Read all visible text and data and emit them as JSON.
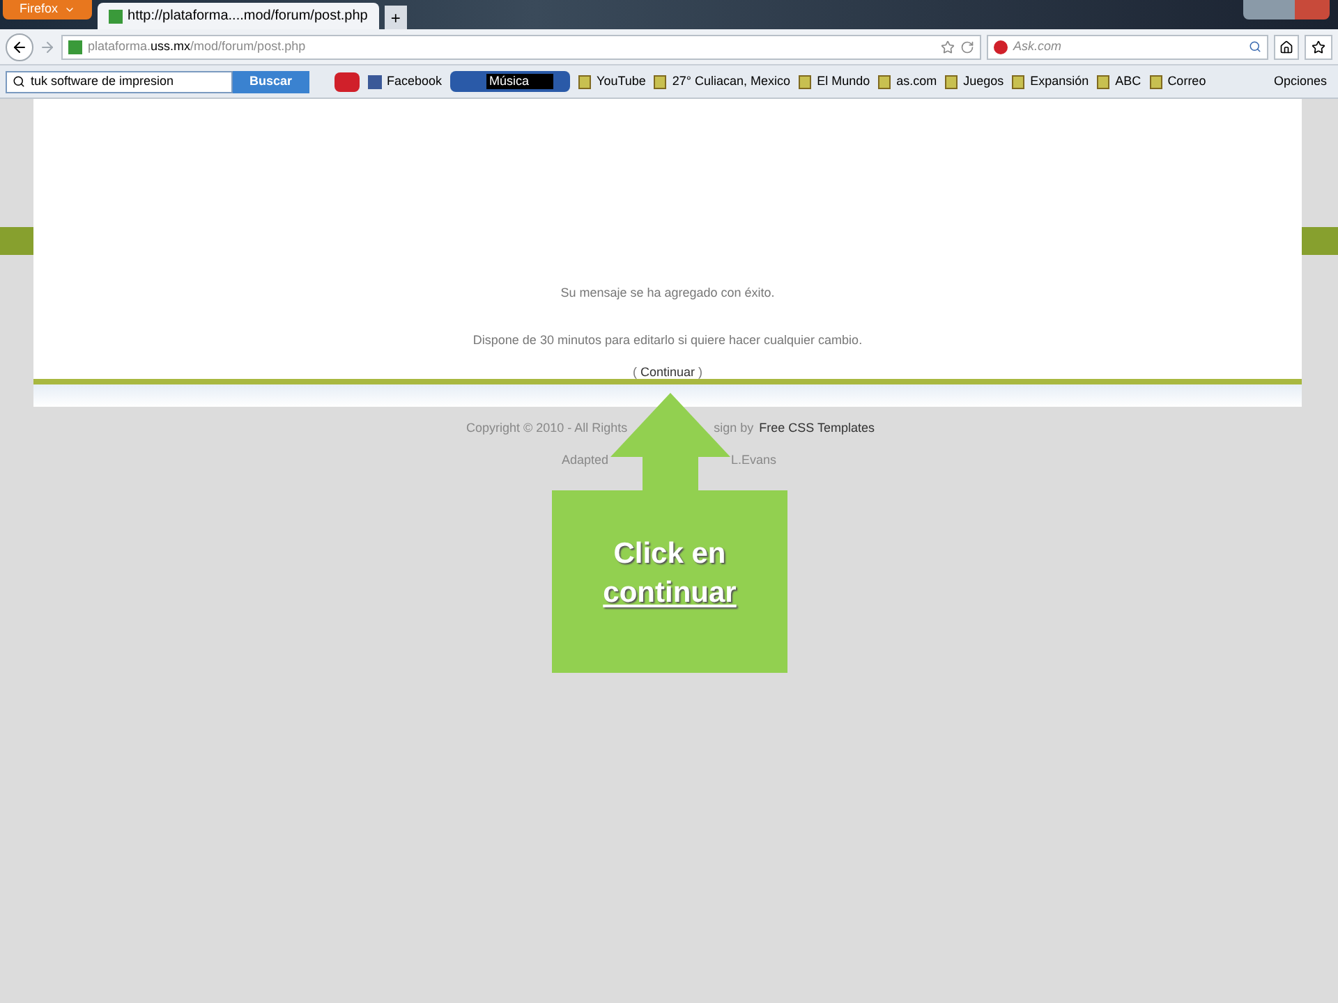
{
  "browser": {
    "menu_button": "Firefox",
    "tabs": [
      {
        "label": "http://plataforma....mod/forum/post.php",
        "selected": true
      }
    ],
    "new_tab": "+",
    "address": {
      "domain_start": "plataforma.",
      "domain": "uss.mx",
      "path": "/mod/forum/post.php"
    },
    "search_engine": {
      "placeholder": "Ask.com"
    }
  },
  "toolbar": {
    "search_value": "tuk software de impresion",
    "search_button": "Buscar",
    "music_label": "Música",
    "bookmarks": [
      {
        "label": "Facebook"
      },
      {
        "label": "YouTube"
      },
      {
        "label": "27° Culiacan, Mexico"
      },
      {
        "label": "El Mundo"
      },
      {
        "label": "as.com"
      },
      {
        "label": "Juegos"
      },
      {
        "label": "Expansión"
      },
      {
        "label": "ABC"
      },
      {
        "label": "Correo"
      }
    ],
    "options": "Opciones"
  },
  "page": {
    "message": "Su mensaje se ha agregado con éxito.",
    "note": "Dispone de 30 minutos para editarlo si quiere hacer cualquier cambio.",
    "continue_open": "(",
    "continue_link": "Continuar",
    "continue_close": ")",
    "footer_line1": [
      "Copyright © 2010 - All Rights",
      "sign by"
    ],
    "footer_link": "Free CSS Templates",
    "footer_line2": [
      "Adapted",
      "L.Evans"
    ]
  },
  "callout": {
    "line1": "Click en",
    "line2": "continuar"
  }
}
